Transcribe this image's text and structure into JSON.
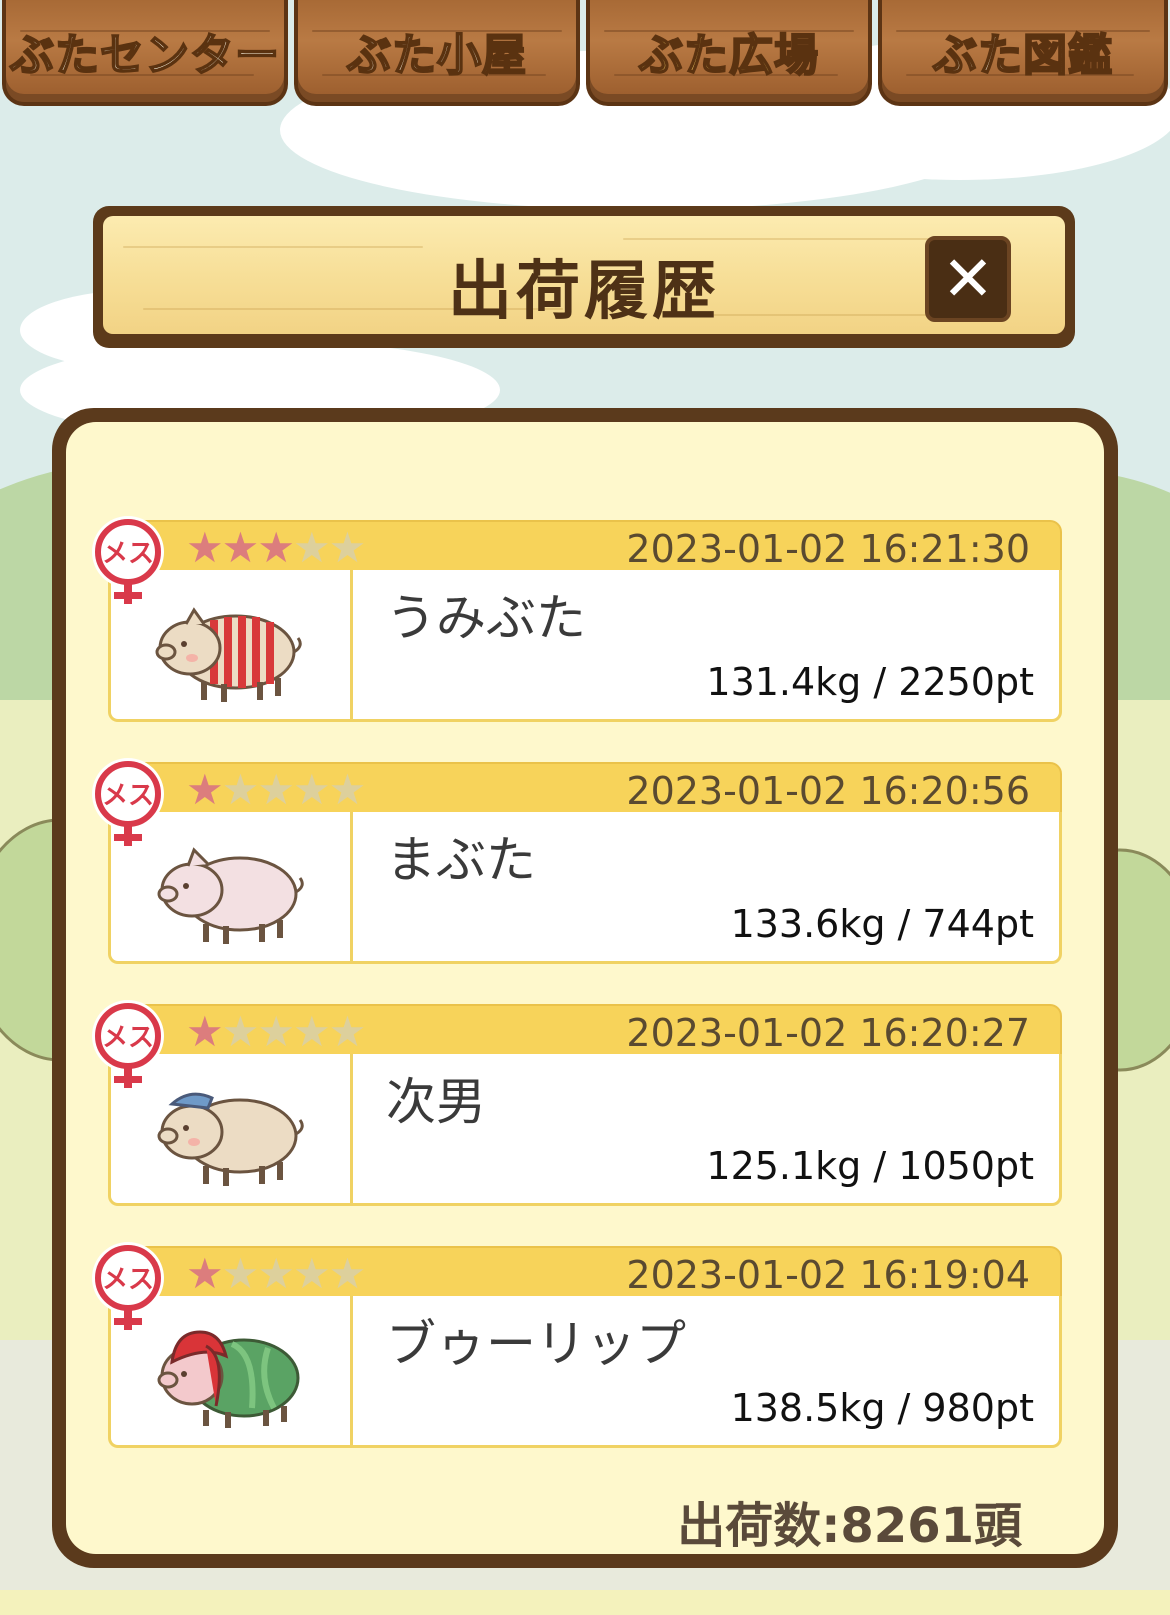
{
  "tabs": [
    {
      "label": "ぶたセンター",
      "active": false
    },
    {
      "label": "ぶた小屋",
      "active": false
    },
    {
      "label": "ぶた広場",
      "active": true
    },
    {
      "label": "ぶた図鑑",
      "active": false
    }
  ],
  "dialog": {
    "title": "出荷履歴",
    "close_symbol": "✕",
    "total_label": "出荷数:8261頭"
  },
  "entries": [
    {
      "gender": "メス",
      "stars": 3,
      "max_stars": 5,
      "date": "2023-01-02 16:21:30",
      "name": "うみぶた",
      "stats": "131.4kg / 2250pt",
      "pig_icon": "striped-pig-icon"
    },
    {
      "gender": "メス",
      "stars": 1,
      "max_stars": 5,
      "date": "2023-01-02 16:20:56",
      "name": "まぶた",
      "stats": "133.6kg / 744pt",
      "pig_icon": "pink-pig-icon"
    },
    {
      "gender": "メス",
      "stars": 1,
      "max_stars": 5,
      "date": "2023-01-02 16:20:27",
      "name": "次男",
      "stats": "125.1kg / 1050pt",
      "pig_icon": "capped-pig-icon"
    },
    {
      "gender": "メス",
      "stars": 1,
      "max_stars": 5,
      "date": "2023-01-02 16:19:04",
      "name": "ブゥーリップ",
      "stats": "138.5kg / 980pt",
      "pig_icon": "tulip-pig-icon"
    }
  ],
  "colors": {
    "header_yellow": "#f7d35a",
    "panel_bg": "#fef8cc",
    "wood_brown": "#5b3a1c",
    "star_on": "#dc7d7d",
    "star_off": "#ddd09c",
    "badge_red": "#d9394a"
  }
}
